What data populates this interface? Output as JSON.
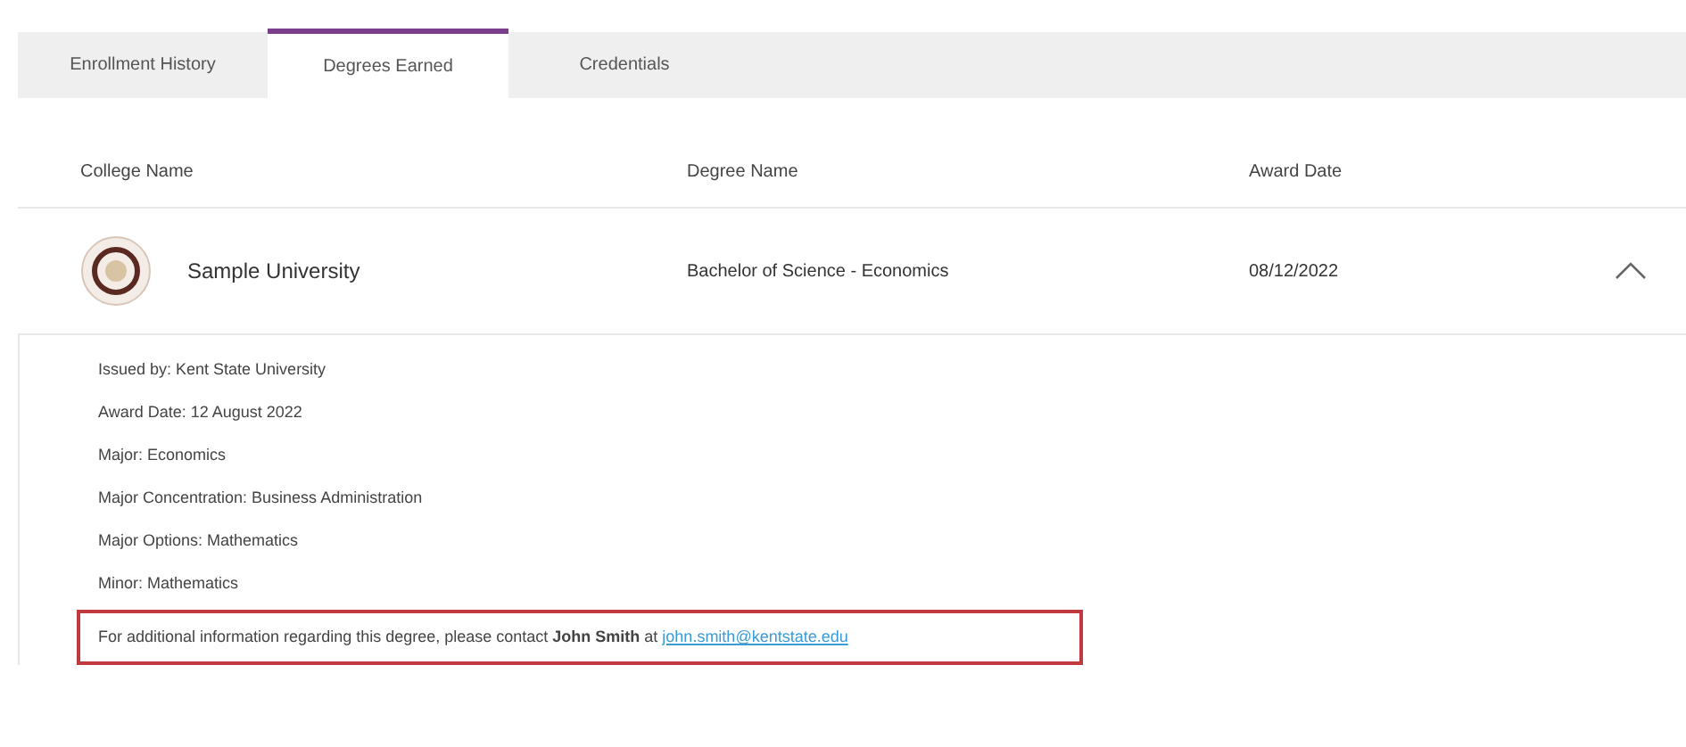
{
  "tabs": [
    {
      "label": "Enrollment History",
      "selected": false
    },
    {
      "label": "Degrees Earned",
      "selected": true
    },
    {
      "label": "Credentials",
      "selected": false
    }
  ],
  "table": {
    "columns": [
      "College Name",
      "Degree Name",
      "Award Date"
    ],
    "rows": [
      {
        "college": "Sample University",
        "degree": "Bachelor of Science - Economics",
        "award_date": "08/12/2022",
        "expanded": true,
        "details": [
          "Issued by: Kent State University",
          "Award Date: 12 August 2022",
          "Major: Economics",
          "Major Concentration: Business Administration",
          "Major Options: Mathematics",
          "Minor: Mathematics"
        ],
        "contact": {
          "text": "For additional information regarding this degree, please contact **John Smith** at",
          "email": "john.smith@kentstate.edu"
        }
      }
    ]
  }
}
